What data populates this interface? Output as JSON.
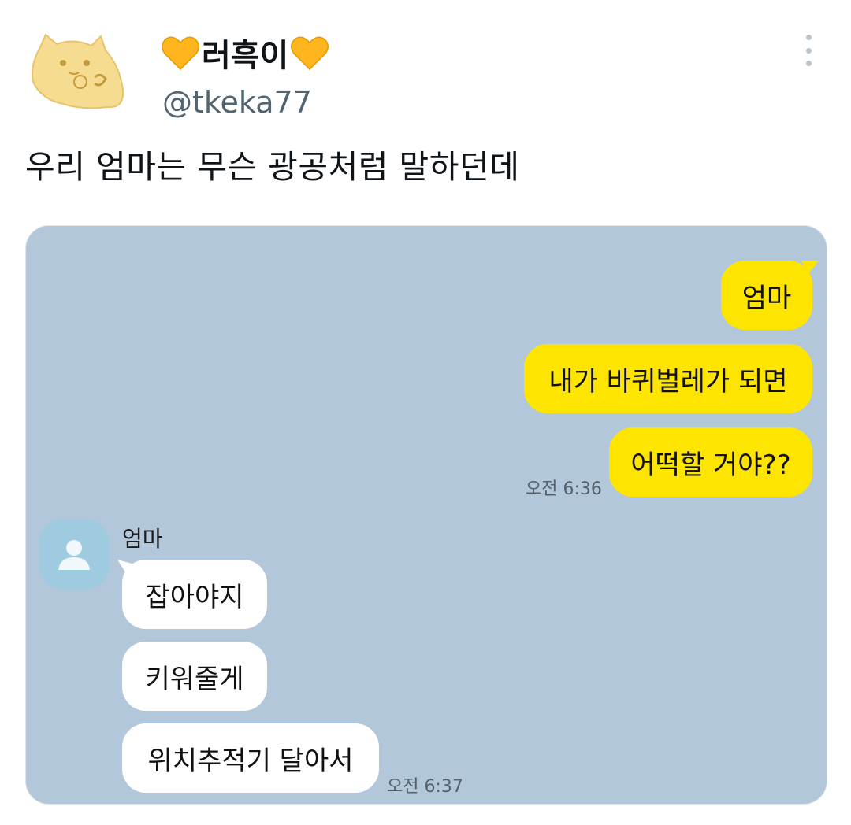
{
  "tweet": {
    "display_name": "러흑이",
    "handle": "@tkeka77",
    "text": "우리 엄마는 무슨 광공처럼 말하던데",
    "avatar_icon": "cat-sticker-avatar",
    "name_decoration_icon": "yellow-heart-icon",
    "more_icon": "vertical-ellipsis-icon"
  },
  "chat": {
    "background_color": "#b2c7d9",
    "sent_bubble_color": "#fee500",
    "received_bubble_color": "#ffffff",
    "sent_messages": [
      "엄마",
      "내가 바퀴벌레가 되면",
      "어떡할 거야??"
    ],
    "sent_time": "오전 6:36",
    "friend_name": "엄마",
    "friend_avatar_icon": "default-profile-icon",
    "received_messages": [
      "잡아야지",
      "키워줄게",
      "위치추적기 달아서"
    ],
    "received_time": "오전 6:37"
  }
}
